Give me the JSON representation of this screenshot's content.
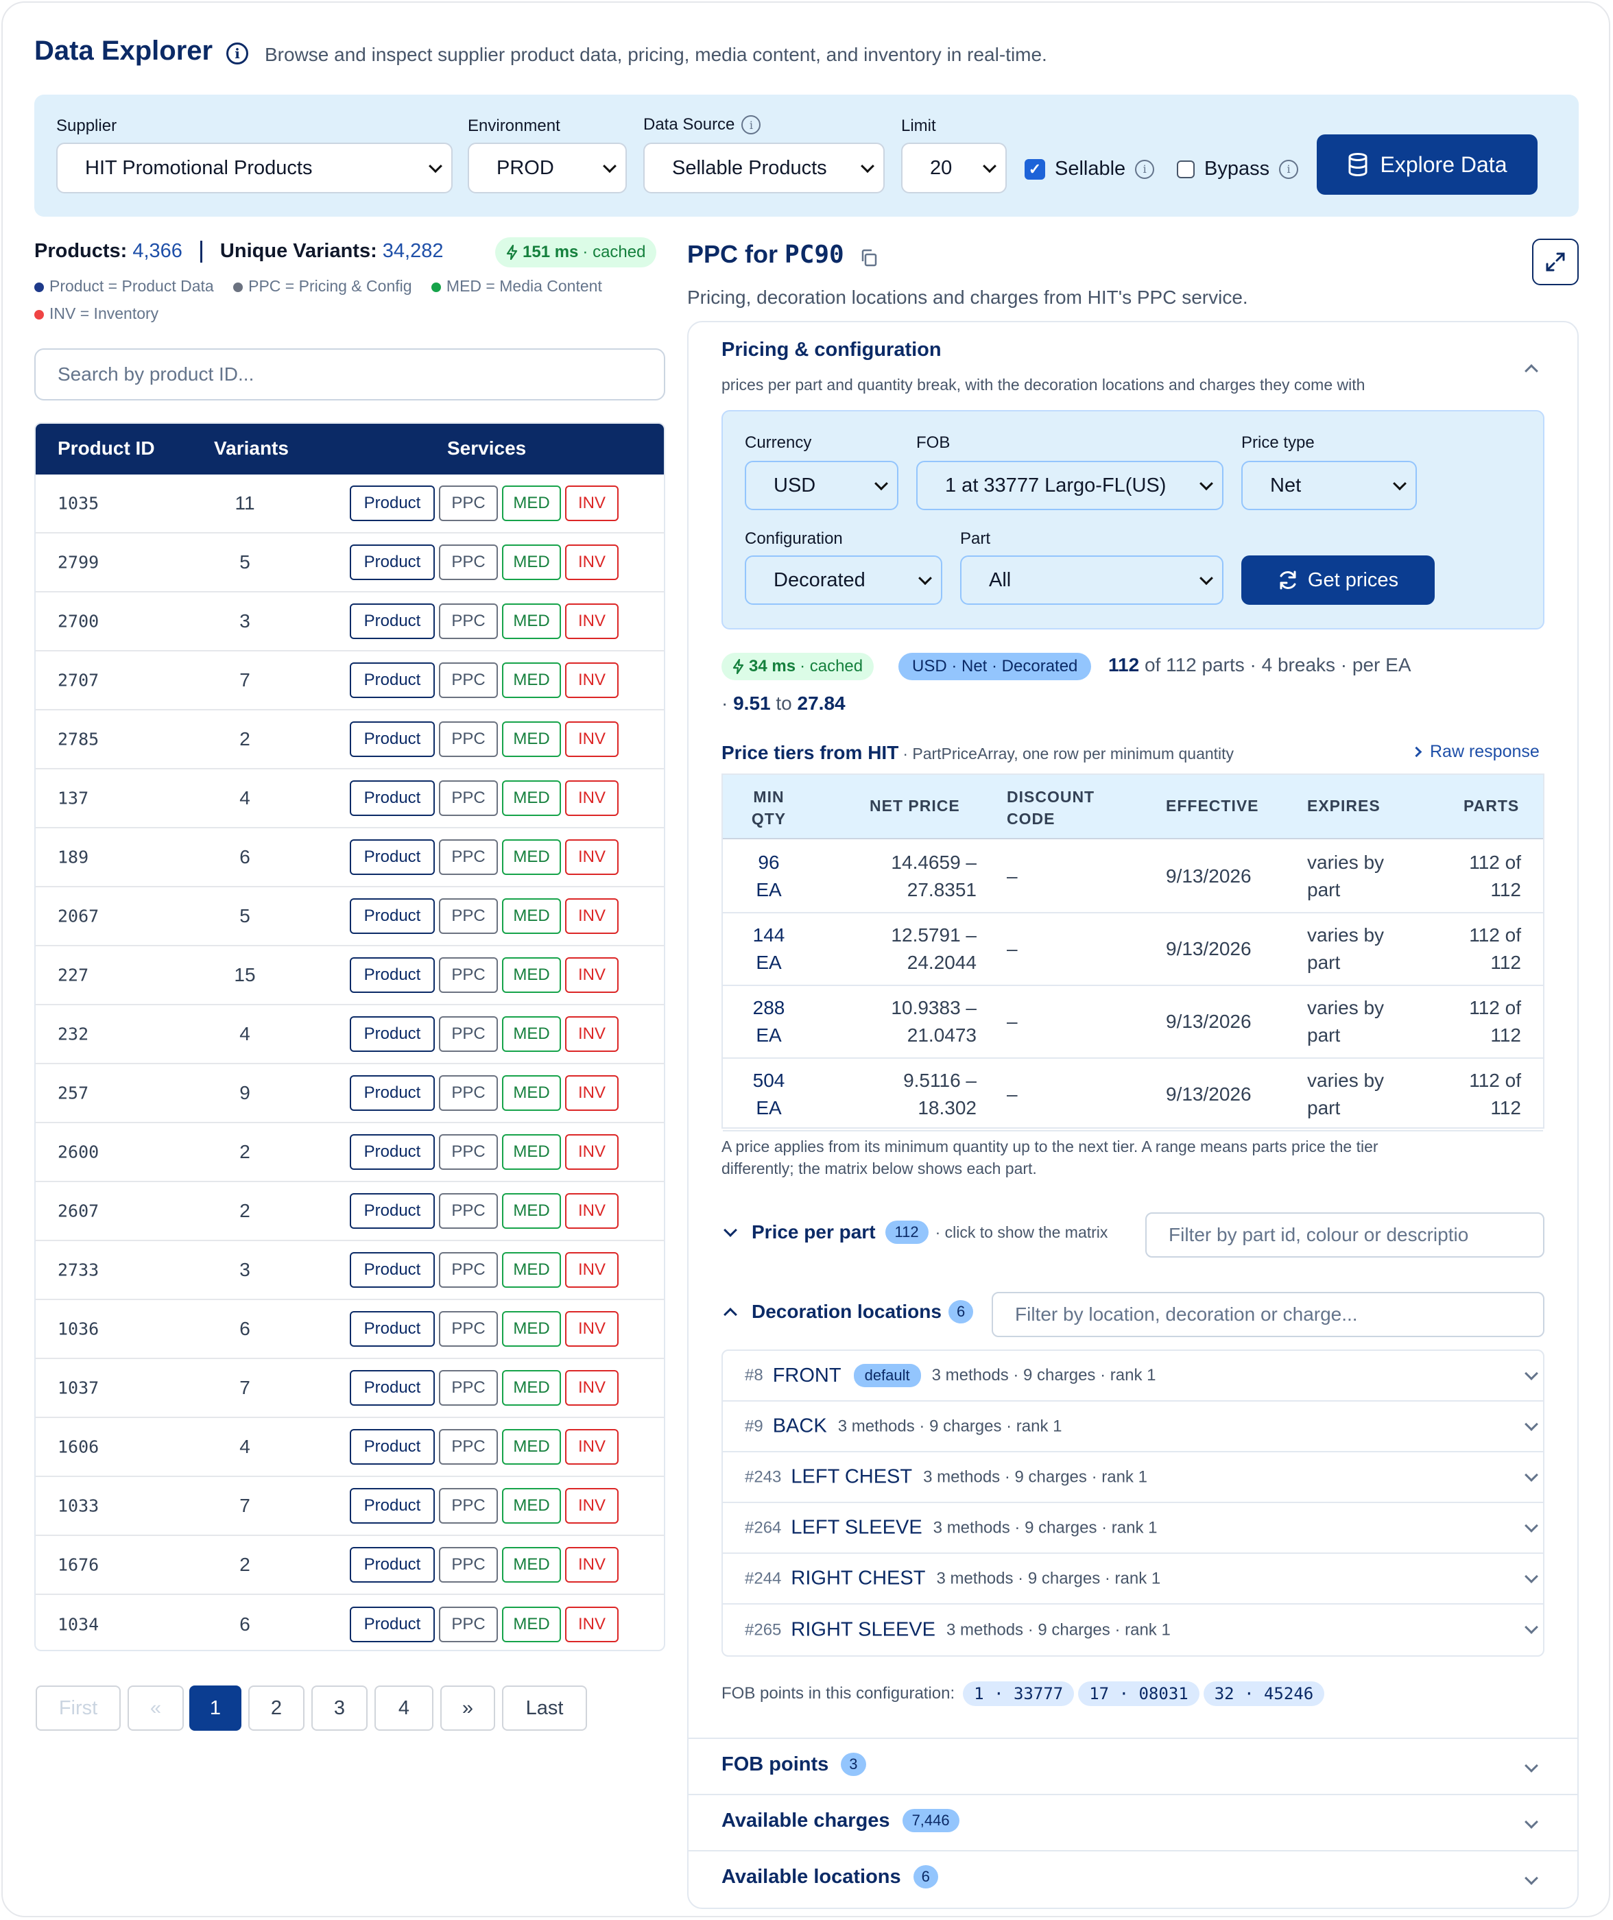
{
  "header": {
    "title": "Data Explorer",
    "subtitle": "Browse and inspect supplier product data, pricing, media content, and inventory in real-time."
  },
  "filters": {
    "supplier_label": "Supplier",
    "supplier_value": "HIT Promotional Products",
    "environment_label": "Environment",
    "environment_value": "PROD",
    "data_source_label": "Data Source",
    "data_source_value": "Sellable Products",
    "limit_label": "Limit",
    "limit_value": "20",
    "sellable_label": "Sellable",
    "sellable_checked": true,
    "bypass_label": "Bypass",
    "bypass_checked": false,
    "explore_button": "Explore Data"
  },
  "stats": {
    "products_label": "Products:",
    "products_value": "4,366",
    "variants_label": "Unique Variants:",
    "variants_value": "34,282",
    "timing": "151 ms",
    "timing_suffix": "· cached"
  },
  "legend": [
    {
      "text": "Product = Product Data",
      "color": "#1e3a8a"
    },
    {
      "text": "PPC = Pricing & Config",
      "color": "#6b7280"
    },
    {
      "text": "MED = Media Content",
      "color": "#16a34a"
    },
    {
      "text": "INV = Inventory",
      "color": "#ef4444"
    }
  ],
  "search": {
    "placeholder": "Search by product ID..."
  },
  "products_table": {
    "headers": [
      "Product ID",
      "Variants",
      "Services"
    ],
    "service_labels": [
      "Product",
      "PPC",
      "MED",
      "INV"
    ],
    "rows": [
      {
        "id": "1035",
        "variants": "11"
      },
      {
        "id": "2799",
        "variants": "5"
      },
      {
        "id": "2700",
        "variants": "3"
      },
      {
        "id": "2707",
        "variants": "7"
      },
      {
        "id": "2785",
        "variants": "2"
      },
      {
        "id": "137",
        "variants": "4"
      },
      {
        "id": "189",
        "variants": "6"
      },
      {
        "id": "2067",
        "variants": "5"
      },
      {
        "id": "227",
        "variants": "15"
      },
      {
        "id": "232",
        "variants": "4"
      },
      {
        "id": "257",
        "variants": "9"
      },
      {
        "id": "2600",
        "variants": "2"
      },
      {
        "id": "2607",
        "variants": "2"
      },
      {
        "id": "2733",
        "variants": "3"
      },
      {
        "id": "1036",
        "variants": "6"
      },
      {
        "id": "1037",
        "variants": "7"
      },
      {
        "id": "1606",
        "variants": "4"
      },
      {
        "id": "1033",
        "variants": "7"
      },
      {
        "id": "1676",
        "variants": "2"
      },
      {
        "id": "1034",
        "variants": "6"
      }
    ]
  },
  "pagination": {
    "first": "First",
    "prev": "«",
    "pages": [
      "1",
      "2",
      "3",
      "4"
    ],
    "current": "1",
    "next": "»",
    "last": "Last"
  },
  "detail": {
    "title_prefix": "PPC for",
    "product_code": "PC90",
    "subtitle": "Pricing, decoration locations and charges from HIT's PPC service.",
    "pricing_section_title": "Pricing & configuration",
    "pricing_section_desc": "prices per part and quantity break, with the decoration locations and charges they come with",
    "currency_label": "Currency",
    "currency_value": "USD",
    "fob_label": "FOB",
    "fob_value": "1 at 33777 Largo-FL(US)",
    "price_type_label": "Price type",
    "price_type_value": "Net",
    "configuration_label": "Configuration",
    "configuration_value": "Decorated",
    "part_label": "Part",
    "part_value": "All",
    "get_prices_button": "Get prices",
    "timing": "34 ms",
    "timing_suffix": "· cached",
    "summary_pill": "USD · Net · Decorated",
    "parts_shown": "112",
    "parts_total_text": "of 112 parts · 4 breaks · per EA",
    "range_prefix": "·",
    "range_low": "9.51",
    "range_to": "to",
    "range_high": "27.84",
    "tiers_title": "Price tiers from HIT",
    "tiers_desc": "· PartPriceArray, one row per minimum quantity",
    "raw_response": "Raw response",
    "tier_headers": [
      "MIN QTY",
      "NET PRICE",
      "DISCOUNT CODE",
      "EFFECTIVE",
      "EXPIRES",
      "PARTS"
    ],
    "tiers": [
      {
        "qty": "96",
        "unit": "EA",
        "price_low": "14.4659 –",
        "price_high": "27.8351",
        "discount": "–",
        "effective": "9/13/2026",
        "expires_1": "varies by",
        "expires_2": "part",
        "parts_1": "112 of",
        "parts_2": "112"
      },
      {
        "qty": "144",
        "unit": "EA",
        "price_low": "12.5791 –",
        "price_high": "24.2044",
        "discount": "–",
        "effective": "9/13/2026",
        "expires_1": "varies by",
        "expires_2": "part",
        "parts_1": "112 of",
        "parts_2": "112"
      },
      {
        "qty": "288",
        "unit": "EA",
        "price_low": "10.9383 –",
        "price_high": "21.0473",
        "discount": "–",
        "effective": "9/13/2026",
        "expires_1": "varies by",
        "expires_2": "part",
        "parts_1": "112 of",
        "parts_2": "112"
      },
      {
        "qty": "504",
        "unit": "EA",
        "price_low": "9.5116 –",
        "price_high": "18.302",
        "discount": "–",
        "effective": "9/13/2026",
        "expires_1": "varies by",
        "expires_2": "part",
        "parts_1": "112 of",
        "parts_2": "112"
      }
    ],
    "tier_note_1": "A price applies from its minimum quantity up to the next tier. A range means parts price the tier",
    "tier_note_2": "differently; the matrix below shows each part.",
    "price_per_part_title": "Price per part",
    "price_per_part_count": "112",
    "price_per_part_hint": "· click to show the matrix",
    "part_filter_placeholder": "Filter by part id, colour or descriptio",
    "decoration_title": "Decoration locations",
    "decoration_count": "6",
    "decoration_filter_placeholder": "Filter by location, decoration or charge...",
    "locations": [
      {
        "num": "#8",
        "name": "FRONT",
        "default_label": "default",
        "meta": "3 methods · 9 charges · rank 1"
      },
      {
        "num": "#9",
        "name": "BACK",
        "default_label": "",
        "meta": "3 methods · 9 charges · rank 1"
      },
      {
        "num": "#243",
        "name": "LEFT CHEST",
        "default_label": "",
        "meta": "3 methods · 9 charges · rank 1"
      },
      {
        "num": "#264",
        "name": "LEFT SLEEVE",
        "default_label": "",
        "meta": "3 methods · 9 charges · rank 1"
      },
      {
        "num": "#244",
        "name": "RIGHT CHEST",
        "default_label": "",
        "meta": "3 methods · 9 charges · rank 1"
      },
      {
        "num": "#265",
        "name": "RIGHT SLEEVE",
        "default_label": "",
        "meta": "3 methods · 9 charges · rank 1"
      }
    ],
    "fob_points_text": "FOB points in this configuration:",
    "fob_chips": [
      "1 · 33777",
      "17 · 08031",
      "32 · 45246"
    ],
    "bottom_sections": [
      {
        "title": "FOB points",
        "count": "3"
      },
      {
        "title": "Available charges",
        "count": "7,446"
      },
      {
        "title": "Available locations",
        "count": "6"
      }
    ]
  }
}
